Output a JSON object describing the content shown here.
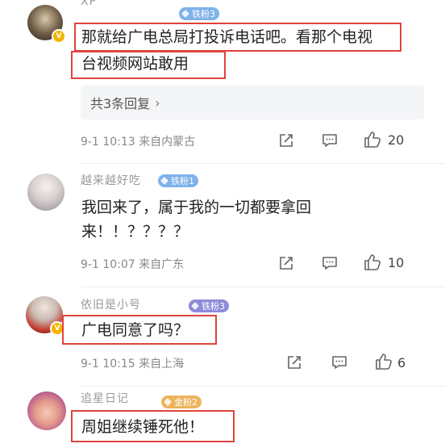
{
  "comments": [
    {
      "username": "XP",
      "badge": "铁粉3",
      "text_lines": [
        "那就给广电总局打投诉电话吧。看那个电视",
        "台视频网站敢用"
      ],
      "replies_label": "共3条回复",
      "time": "9-1 10:13",
      "location": "来自内蒙古",
      "likes": "20"
    },
    {
      "username": "越来越好吃",
      "badge": "铁粉1",
      "text_lines": [
        "我回来了，属于我的一切都要拿回",
        "来！！？？？？"
      ],
      "time": "9-1 10:07",
      "location": "来自广东",
      "likes": "10"
    },
    {
      "username": "依旧是小号",
      "badge": "铁粉3",
      "text_lines": [
        "广电同意了吗？"
      ],
      "time": "9-1 10:15",
      "location": "来自上海",
      "likes": "6"
    },
    {
      "username": "追星日记",
      "badge": "金粉2",
      "text_lines": [
        "周姐继续锤死他！"
      ]
    }
  ],
  "colors": {
    "highlight": "#e0433b",
    "meta": "#888888",
    "badge_blue": "#7fb2ea",
    "badge_purple": "#8e8bd9",
    "badge_gold": "#ecb45c"
  },
  "icons": {
    "share": "share-icon",
    "comment": "comment-icon",
    "like": "thumb-up-icon",
    "verified": "verified-v-icon",
    "chevron": "chevron-right-icon"
  }
}
